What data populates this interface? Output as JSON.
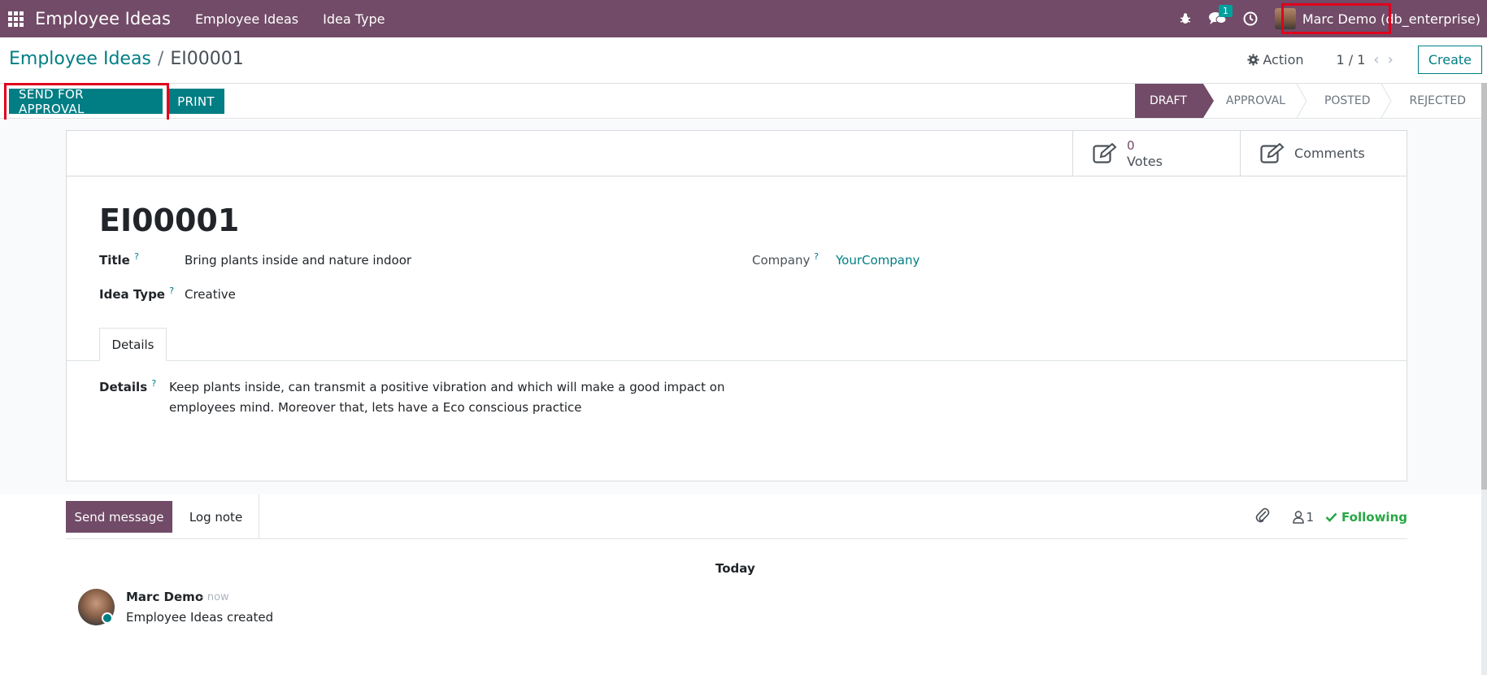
{
  "navbar": {
    "brand": "Employee Ideas",
    "menus": [
      "Employee Ideas",
      "Idea Type"
    ],
    "messages_badge": "1",
    "user_name": "Marc Demo (db_enterprise)"
  },
  "breadcrumb": {
    "parent": "Employee Ideas",
    "separator": "/",
    "current": "EI00001"
  },
  "control": {
    "action_label": "Action",
    "pager": "1 / 1",
    "create_label": "Create"
  },
  "buttons": {
    "send_for_approval": "SEND FOR APPROVAL",
    "print": "PRINT"
  },
  "stages": [
    "DRAFT",
    "APPROVAL",
    "POSTED",
    "REJECTED"
  ],
  "smart_buttons": {
    "votes_value": "0",
    "votes_label": "Votes",
    "comments_label": "Comments"
  },
  "record": {
    "name": "EI00001",
    "title_label": "Title",
    "title_value": "Bring plants inside and nature indoor",
    "idea_type_label": "Idea Type",
    "idea_type_value": "Creative",
    "company_label": "Company",
    "company_value": "YourCompany",
    "help_mark": "?"
  },
  "tabs": {
    "details_tab": "Details"
  },
  "details": {
    "label": "Details",
    "line1": "Keep plants inside, can transmit a positive vibration and which will make a good impact on",
    "line2": "employees mind. Moreover that, lets have a Eco conscious practice"
  },
  "chatter": {
    "send_message": "Send message",
    "log_note": "Log note",
    "followers_count": "1",
    "following_label": "Following",
    "date_separator": "Today",
    "message": {
      "author": "Marc Demo",
      "time": "- now",
      "body": "Employee Ideas created"
    }
  },
  "colors": {
    "brand_purple": "#714b67",
    "accent_teal": "#017e84",
    "highlight_red": "#e0001b",
    "following_green": "#28a745"
  }
}
